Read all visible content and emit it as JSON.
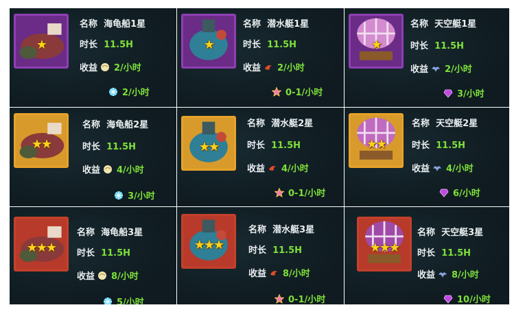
{
  "colors": {
    "value_green": "#7fe03a",
    "label_white": "#e9eef0",
    "card_bg": "#0f1b20"
  },
  "cards": [
    {
      "name_label": "名称",
      "name": "海龟船1星",
      "time_label": "时长",
      "time": "11.5H",
      "income_label": "收益",
      "income1": "2/小时",
      "income1_icon": "shell-icon",
      "income2": "2/小时",
      "income2_icon": "snowflake-crystal-icon",
      "stars": "★",
      "frame": "purple",
      "vehicle": "turtle-ship-icon"
    },
    {
      "name_label": "名称",
      "name": "潜水艇1星",
      "time_label": "时长",
      "time": "11.5H",
      "income_label": "收益",
      "income1": "2/小时",
      "income1_icon": "shrimp-icon",
      "income2": "0-1/小时",
      "income2_icon": "pink-star-icon",
      "stars": "★",
      "frame": "purple",
      "vehicle": "submarine-icon"
    },
    {
      "name_label": "名称",
      "name": "天空艇1星",
      "time_label": "时长",
      "time": "11.5H",
      "income_label": "收益",
      "income1": "2/小时",
      "income1_icon": "bird-icon",
      "income2": "3/小时",
      "income2_icon": "purple-gem-icon",
      "stars": "★",
      "frame": "purple",
      "vehicle": "airship-icon"
    },
    {
      "name_label": "名称",
      "name": "海龟船2星",
      "time_label": "时长",
      "time": "11.5H",
      "income_label": "收益",
      "income1": "4/小时",
      "income1_icon": "shell-icon",
      "income2": "3/小时",
      "income2_icon": "snowflake-crystal-icon",
      "stars": "★★",
      "frame": "orange",
      "vehicle": "turtle-ship-icon"
    },
    {
      "name_label": "名称",
      "name": "潜水艇2星",
      "time_label": "时长",
      "time": "11.5H",
      "income_label": "收益",
      "income1": "4/小时",
      "income1_icon": "shrimp-icon",
      "income2": "0-1/小时",
      "income2_icon": "pink-star-icon",
      "stars": "★★",
      "frame": "orange",
      "vehicle": "submarine-icon"
    },
    {
      "name_label": "名称",
      "name": "天空艇2星",
      "time_label": "时长",
      "time": "11.5H",
      "income_label": "收益",
      "income1": "4/小时",
      "income1_icon": "bird-icon",
      "income2": "6/小时",
      "income2_icon": "purple-gem-icon",
      "stars": "★★",
      "frame": "orange",
      "vehicle": "airship-icon"
    },
    {
      "name_label": "名称",
      "name": "海龟船3星",
      "time_label": "时长",
      "time": "11.5H",
      "income_label": "收益",
      "income1": "8/小时",
      "income1_icon": "shell-icon",
      "income2": "5/小时",
      "income2_icon": "snowflake-crystal-icon",
      "stars": "★★★",
      "frame": "red",
      "vehicle": "turtle-ship-icon"
    },
    {
      "name_label": "名称",
      "name": "潜水艇3星",
      "time_label": "时长",
      "time": "11.5H",
      "income_label": "收益",
      "income1": "8/小时",
      "income1_icon": "shrimp-icon",
      "income2": "0-1/小时",
      "income2_icon": "pink-star-icon",
      "stars": "★★★",
      "frame": "red",
      "vehicle": "submarine-icon"
    },
    {
      "name_label": "名称",
      "name": "天空艇3星",
      "time_label": "时长",
      "time": "11.5H",
      "income_label": "收益",
      "income1": "8/小时",
      "income1_icon": "bird-icon",
      "income2": "10/小时",
      "income2_icon": "purple-gem-icon",
      "stars": "★★★",
      "frame": "red",
      "vehicle": "airship-icon"
    }
  ]
}
